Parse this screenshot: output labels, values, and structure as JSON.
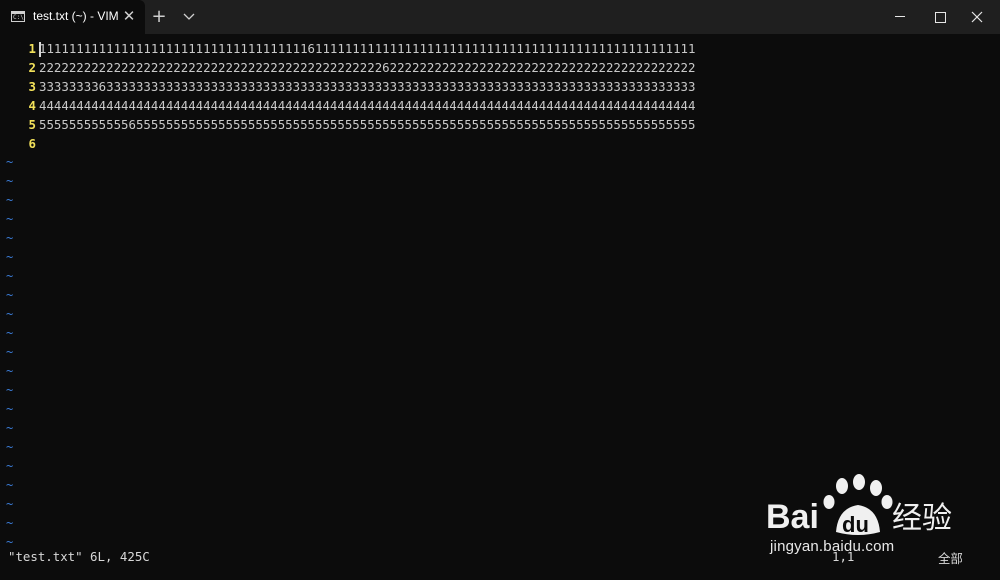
{
  "window": {
    "tab_title": "test.txt (~) - VIM",
    "tab_icon_text": "C:\\",
    "close_tab_glyph": "✕",
    "new_tab_glyph": "+",
    "icons": [
      "terminal-icon",
      "close-icon",
      "plus-icon",
      "chevron-down-icon",
      "minimize-icon",
      "maximize-icon",
      "close-window-icon"
    ]
  },
  "editor": {
    "lines": [
      {
        "num": "1",
        "text": "1111111111111111111111111111111111116111111111111111111111111111111111111111111111111111"
      },
      {
        "num": "2",
        "text": "2222222222222222222222222222222222222222222222622222222222222222222222222222222222222222"
      },
      {
        "num": "3",
        "text": "3333333363333333333333333333333333333333333333333333333333333333333333333333333333333333"
      },
      {
        "num": "4",
        "text": "4444444444444444444444444444444444444444444444444444444444444444444444444444444444444444"
      },
      {
        "num": "5",
        "text": "5555555555556555555555555555555555555555555555555555555555555555555555555555555555555555"
      },
      {
        "num": "6",
        "text": ""
      }
    ],
    "tilde": "~",
    "tilde_count": 21
  },
  "status": {
    "file_info": "\"test.txt\" 6L, 425C",
    "position": "1,1",
    "scroll": "全部"
  },
  "watermark": {
    "logo": "Bai du 经验",
    "url": "jingyan.baidu.com"
  },
  "colors": {
    "background": "#0c0c0c",
    "line_number": "#f2e15a",
    "tilde": "#3b7dd8",
    "text": "#c8c8c8"
  }
}
